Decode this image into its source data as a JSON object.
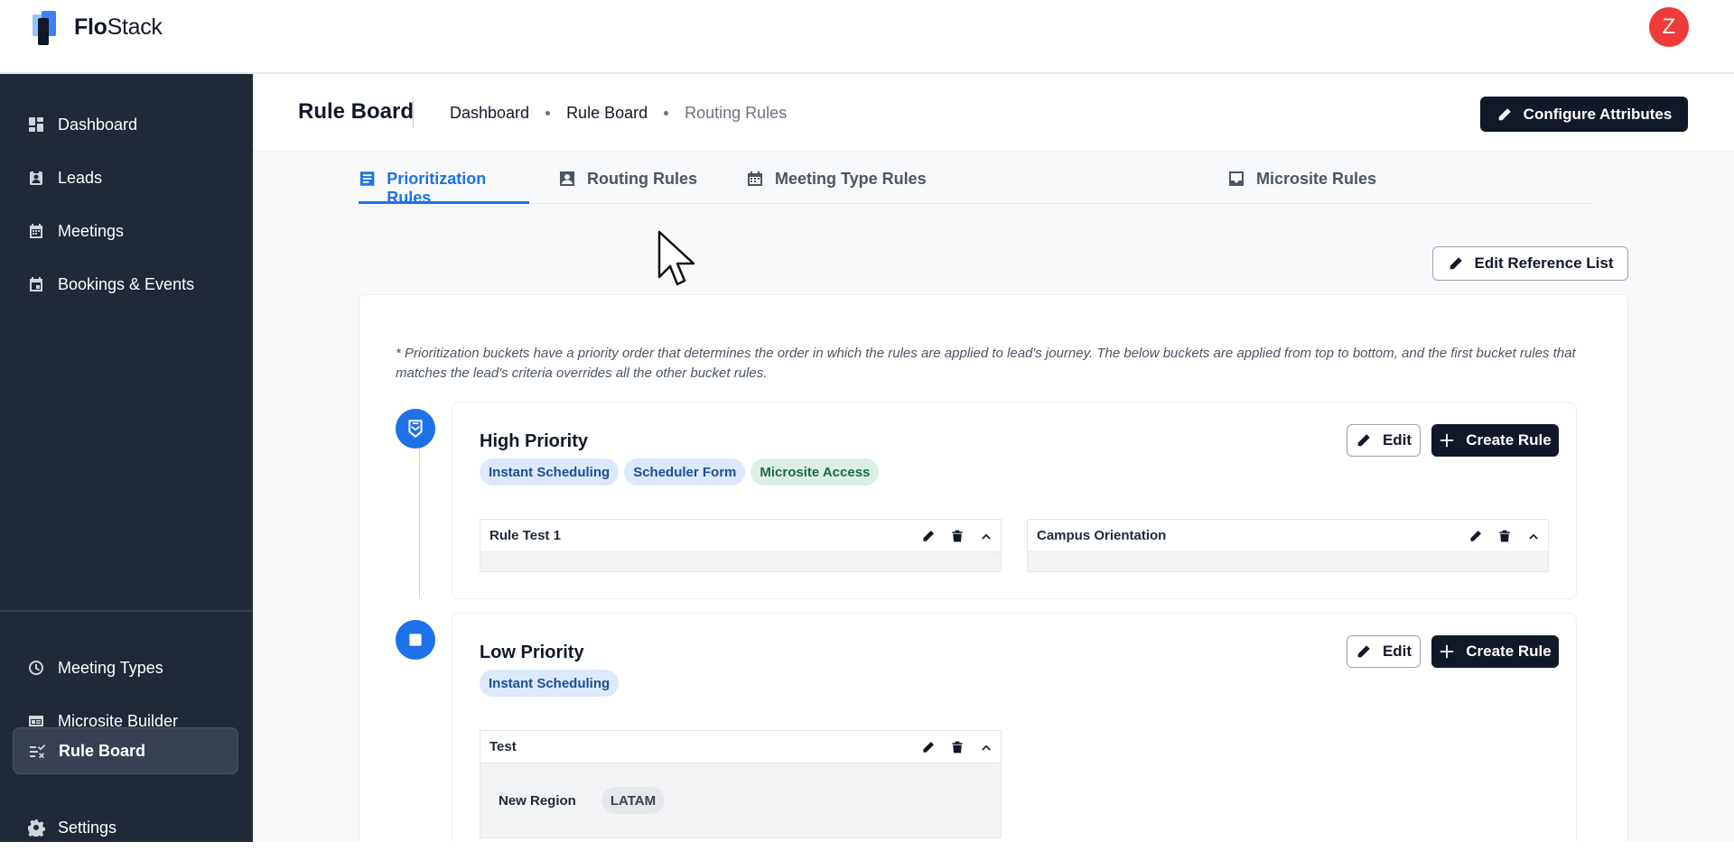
{
  "app": {
    "logo_bold": "Flo",
    "logo_light": "Stack",
    "avatar_initial": "Z",
    "accent": "#1d72e8"
  },
  "sidebar": {
    "items": [
      {
        "label": "Dashboard",
        "icon": "dashboard-icon"
      },
      {
        "label": "Leads",
        "icon": "leads-icon"
      },
      {
        "label": "Meetings",
        "icon": "calendar-icon"
      },
      {
        "label": "Bookings & Events",
        "icon": "event-icon"
      },
      {
        "label": "Meeting Types",
        "icon": "clock-icon"
      },
      {
        "label": "Microsite Builder",
        "icon": "browser-icon"
      },
      {
        "label": "Rule Board",
        "icon": "rules-icon",
        "active": true
      },
      {
        "label": "Settings",
        "icon": "gear-icon"
      }
    ]
  },
  "header": {
    "title": "Rule Board",
    "breadcrumbs": [
      "Dashboard",
      "Rule Board",
      "Routing Rules"
    ],
    "configure_label": "Configure Attributes"
  },
  "tabs": [
    {
      "label": "Prioritization Rules",
      "active": true
    },
    {
      "label": "Routing Rules"
    },
    {
      "label": "Meeting Type Rules"
    },
    {
      "label": "Microsite Rules"
    }
  ],
  "edit_reference_label": "Edit Reference List",
  "note": "* Prioritization buckets have a priority order that determines the order in which the rules are applied to lead's journey. The below buckets are applied from top to bottom, and the first bucket rules that matches the lead's criteria overrides all the other bucket rules.",
  "buckets": [
    {
      "title": "High Priority",
      "tags": [
        "Instant Scheduling",
        "Scheduler Form",
        "Microsite Access"
      ],
      "edit_label": "Edit",
      "create_label": "Create Rule",
      "rules": [
        {
          "name": "Rule Test 1"
        },
        {
          "name": "Campus Orientation"
        }
      ]
    },
    {
      "title": "Low Priority",
      "tags": [
        "Instant Scheduling"
      ],
      "edit_label": "Edit",
      "create_label": "Create Rule",
      "rules": [
        {
          "name": "Test",
          "attribute": "New Region",
          "value": "LATAM"
        }
      ]
    }
  ]
}
